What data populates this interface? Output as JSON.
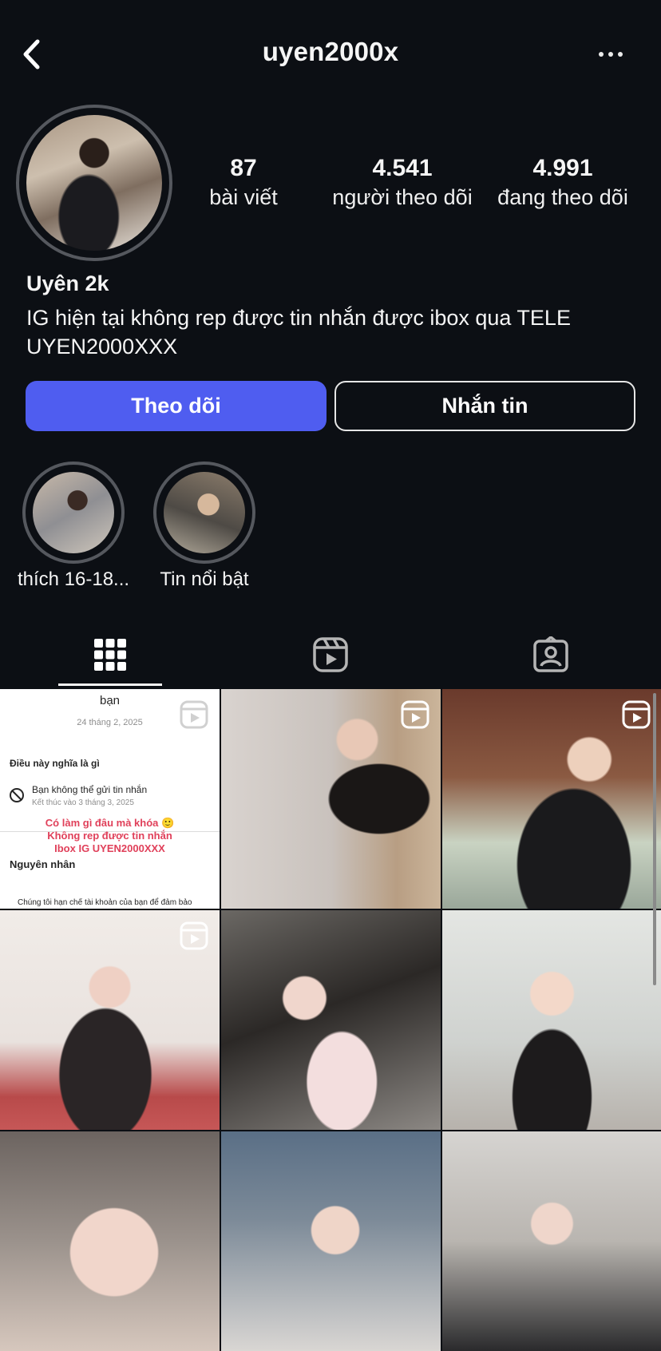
{
  "header": {
    "username": "uyen2000x"
  },
  "stats": [
    {
      "value": "87",
      "label": "bài viết"
    },
    {
      "value": "4.541",
      "label": "người theo dõi"
    },
    {
      "value": "4.991",
      "label": "đang theo dõi"
    }
  ],
  "profile": {
    "display_name": "Uyên 2k",
    "bio_line1": "IG hiện tại không rep được tin nhắn được ibox qua TELE",
    "bio_line2": "UYEN2000XXX"
  },
  "actions": {
    "follow_label": "Theo dõi",
    "message_label": "Nhắn tin",
    "follow_color": "#4f5df0"
  },
  "highlights": [
    {
      "label": "thích 16-18..."
    },
    {
      "label": "Tin nổi bật"
    }
  ],
  "tabs": [
    {
      "icon": "grid-icon",
      "active": true
    },
    {
      "icon": "reels-icon",
      "active": false
    },
    {
      "icon": "tagged-icon",
      "active": false
    }
  ],
  "posts": {
    "first_post_text": {
      "heading": "bạn",
      "date": "24 tháng 2, 2025",
      "section1": "Điều này nghĩa là gì",
      "item": "Bạn không thể gửi tin nhắn",
      "item_sub": "Kết thúc vào 3 tháng 3, 2025",
      "overlay_line1": "Có làm gì đâu mà khóa 🙂",
      "overlay_line2": "Không rep được tin nhắn",
      "overlay_line3": "Ibox IG UYEN2000XXX",
      "section2": "Nguyên nhân",
      "footer": "Chúng tôi hạn chế tài khoản của bạn để đảm bảo"
    }
  }
}
